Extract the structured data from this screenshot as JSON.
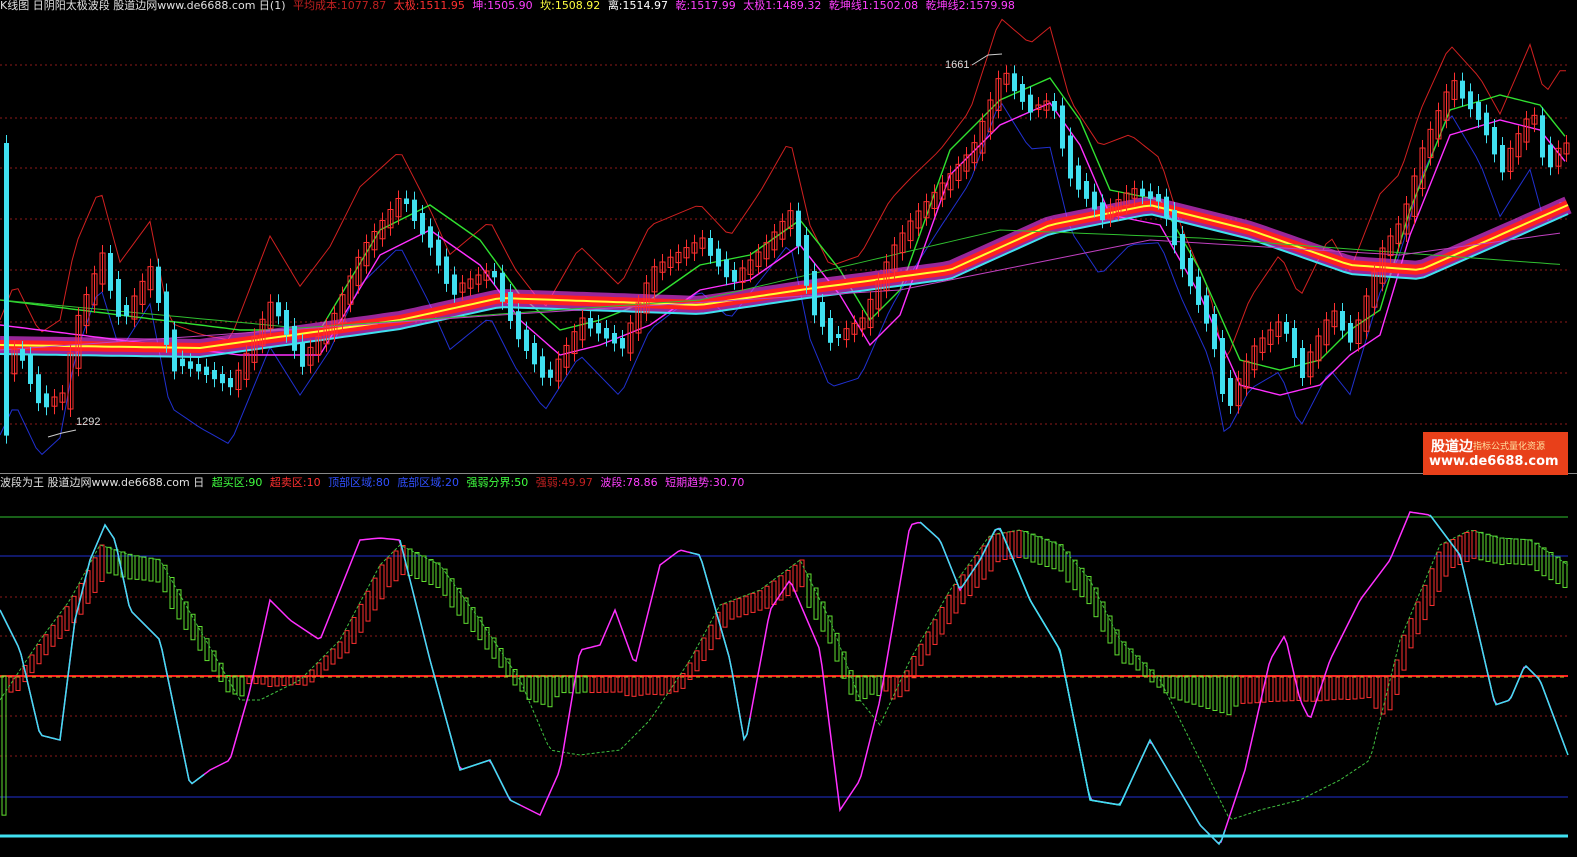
{
  "top_panel": {
    "title": "K线图 日阴阳太极波段 股道边网www.de6688.com 日(1)",
    "indicators": [
      {
        "label": "平均成本:1077.87",
        "color": "#c02020"
      },
      {
        "label": "太极:1511.95",
        "color": "#ff3030"
      },
      {
        "label": "坤:1505.90",
        "color": "#ff40ff"
      },
      {
        "label": "坎:1508.92",
        "color": "#ffff40"
      },
      {
        "label": "离:1514.97",
        "color": "#ffffff"
      },
      {
        "label": "乾:1517.99",
        "color": "#ff40ff"
      },
      {
        "label": "太极1:1489.32",
        "color": "#ff40ff"
      },
      {
        "label": "乾坤线1:1502.08",
        "color": "#ff40ff"
      },
      {
        "label": "乾坤线2:1579.98",
        "color": "#ff40ff"
      }
    ],
    "peak_high": "1661",
    "peak_low": "1292"
  },
  "bottom_panel": {
    "title": "波段为王 股道边网www.de6688.com 日",
    "indicators": [
      {
        "label": "超买区:90",
        "color": "#40ff40"
      },
      {
        "label": "超卖区:10",
        "color": "#ff3030"
      },
      {
        "label": "顶部区域:80",
        "color": "#3050ff"
      },
      {
        "label": "底部区域:20",
        "color": "#3050ff"
      },
      {
        "label": "强弱分界:50",
        "color": "#40ff40"
      },
      {
        "label": "强弱:49.97",
        "color": "#c02020"
      },
      {
        "label": "波段:78.86",
        "color": "#ff40ff"
      },
      {
        "label": "短期趋势:30.70",
        "color": "#ff40ff"
      }
    ]
  },
  "watermark": {
    "name": "股道边",
    "tagline": "指标公式量化资源",
    "url": "www.de6688.com"
  },
  "colors": {
    "up": "#ff3030",
    "down": "#40e0f0",
    "background": "#000000",
    "grid": "#8b1a1a"
  }
}
